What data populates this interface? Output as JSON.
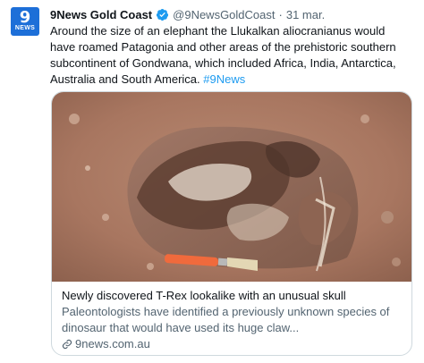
{
  "tweet": {
    "avatar_nine": "9",
    "avatar_word": "NEWS",
    "author_name": "9News Gold Coast",
    "author_handle": "@9NewsGoldCoast",
    "separator": "·",
    "date": "31 mar.",
    "text": "Around the size of an elephant the Llukalkan aliocranianus would have roamed Patagonia and other areas of the prehistoric southern subcontinent of Gondwana, which included Africa, India, Antarctica, Australia and South America.",
    "hashtag": "#9News"
  },
  "card": {
    "title": "Newly discovered T-Rex lookalike with an unusual skull",
    "description": "Paleontologists have identified a previously unknown species of dinosaur that would have used its huge claw...",
    "domain": "9news.com.au"
  },
  "colors": {
    "link": "#1d9bf0",
    "secondary_text": "#536471",
    "avatar_bg": "#1d6fd8",
    "verified": "#1d9bf0"
  }
}
